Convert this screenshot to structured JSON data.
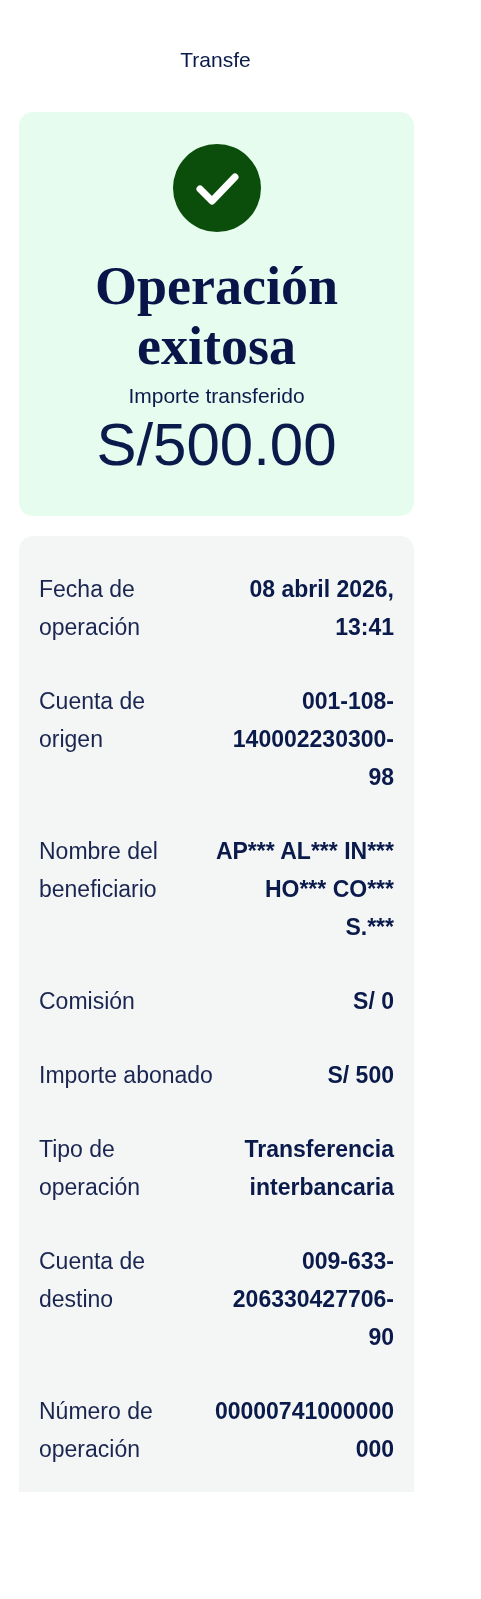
{
  "header": {
    "title": "Transfe"
  },
  "result": {
    "title": "Operación exitosa",
    "amount_label": "Importe transferido",
    "amount": "S/500.00"
  },
  "details": [
    {
      "label": "Fecha de operación",
      "value": "08 abril 2026, 13:41"
    },
    {
      "label": "Cuenta de origen",
      "value": "001-108-140002230300-98"
    },
    {
      "label": "Nombre del beneficiario",
      "value": "AP*** AL*** IN*** HO*** CO*** S.***"
    },
    {
      "label": "Comisión",
      "value": "S/ 0"
    },
    {
      "label": "Importe abonado",
      "value": "S/ 500"
    },
    {
      "label": "Tipo de operación",
      "value": "Transferencia interbancaria"
    },
    {
      "label": "Cuenta de destino",
      "value": "009-633-206330427706-90"
    },
    {
      "label": "Número de operación",
      "value": "00000741000000000"
    }
  ]
}
